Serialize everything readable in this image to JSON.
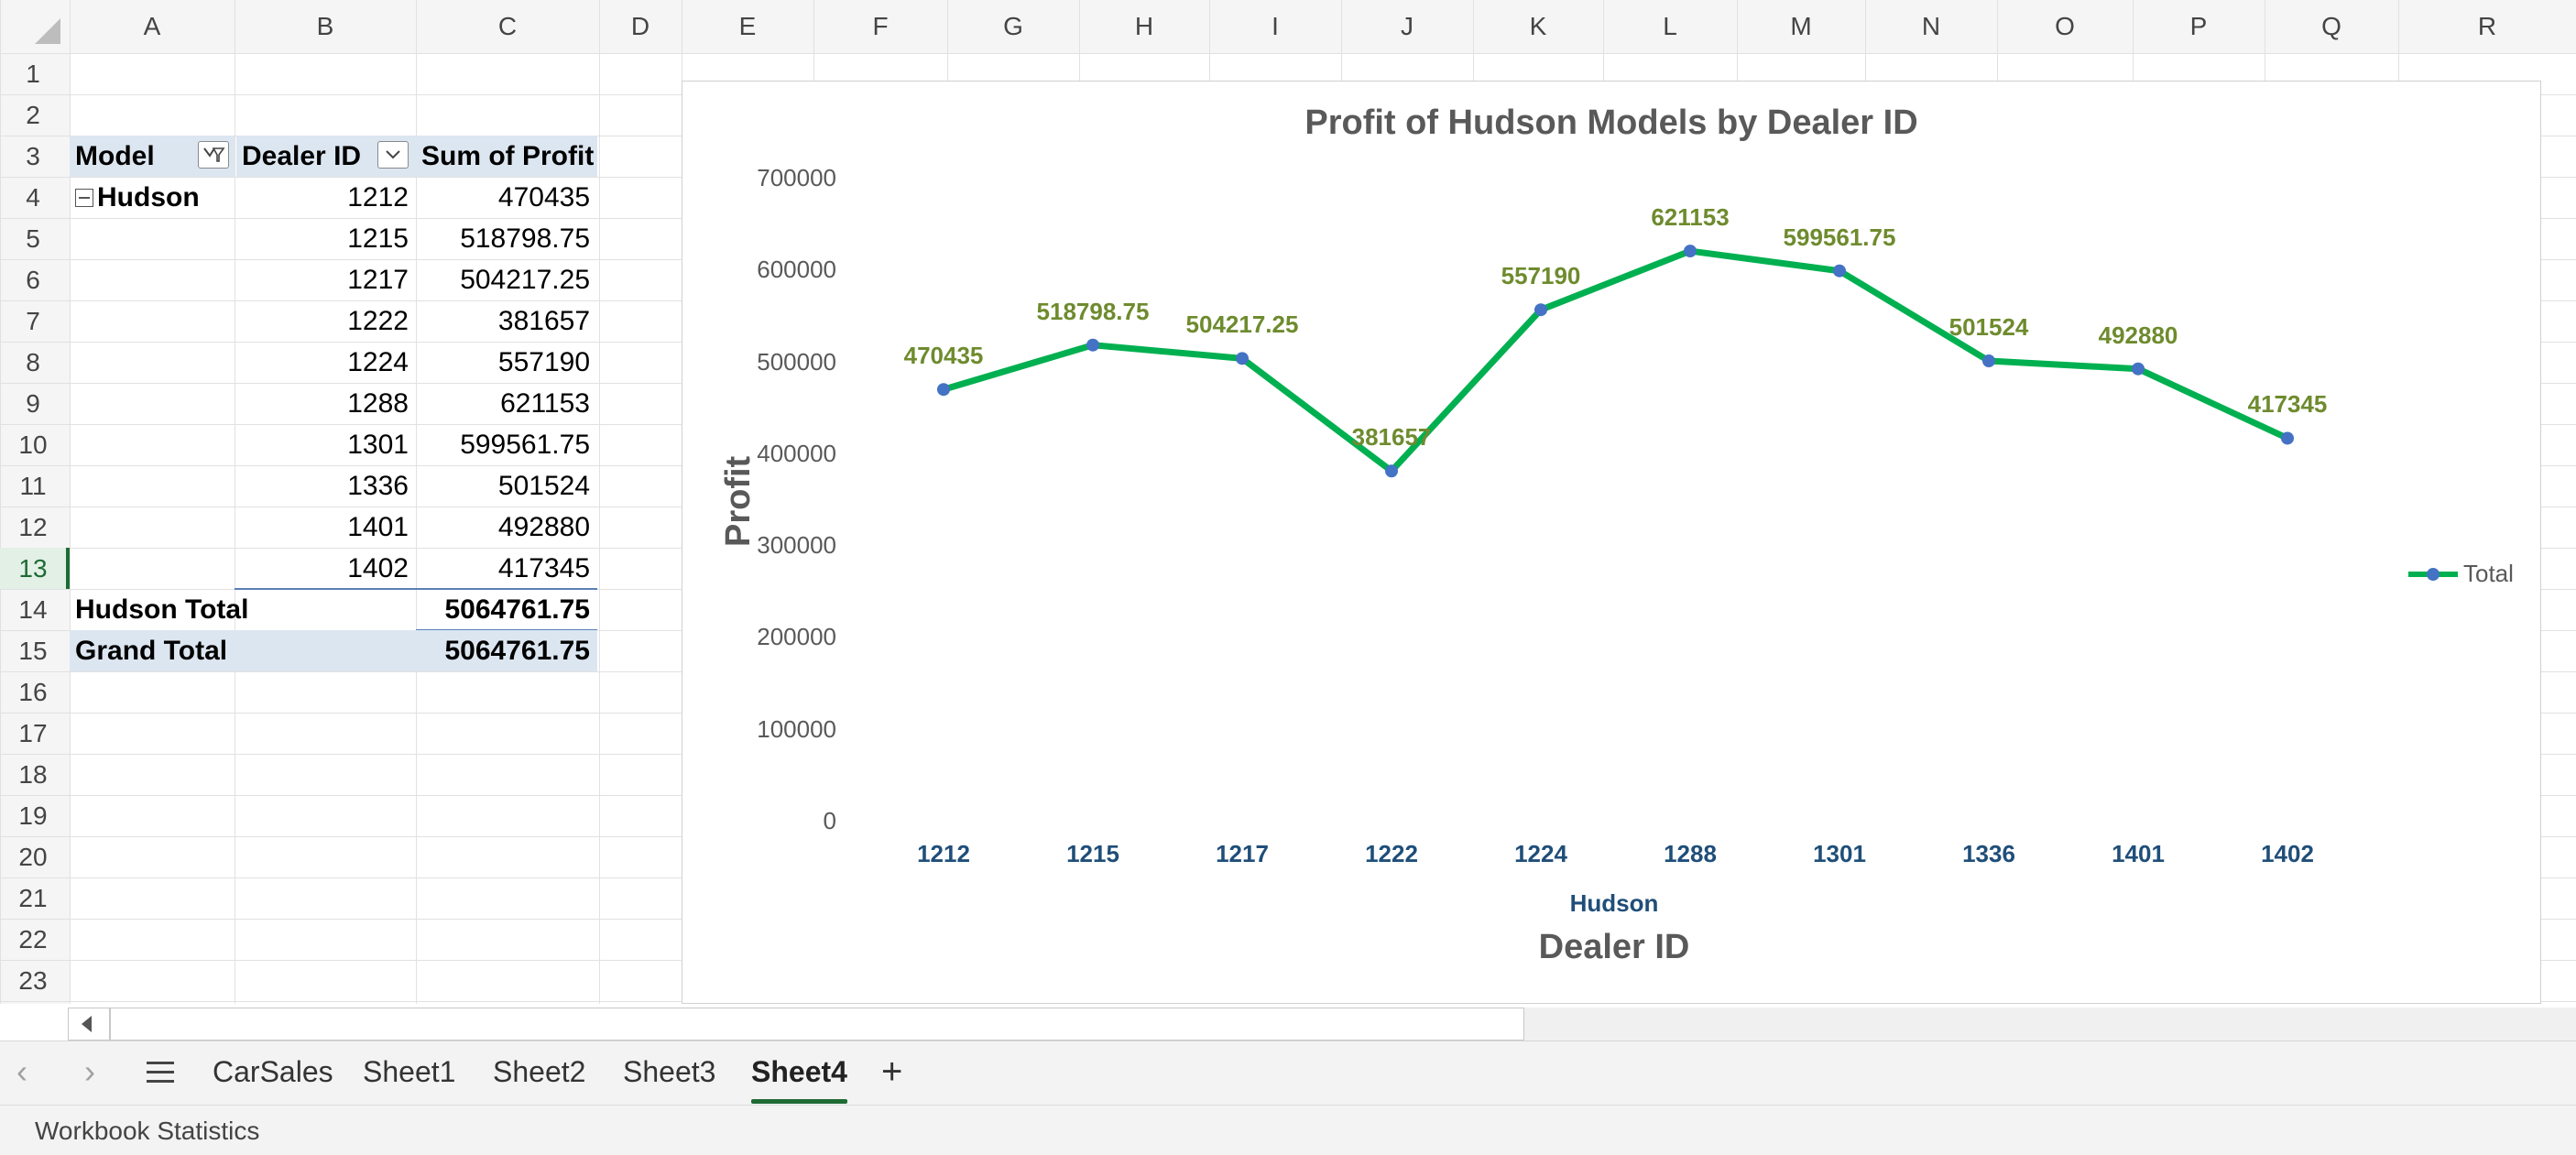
{
  "columns": [
    "A",
    "B",
    "C",
    "D",
    "E",
    "F",
    "G",
    "H",
    "I",
    "J",
    "K",
    "L",
    "M",
    "N",
    "O",
    "P",
    "Q",
    "R"
  ],
  "rows": [
    "1",
    "2",
    "3",
    "4",
    "5",
    "6",
    "7",
    "8",
    "9",
    "10",
    "11",
    "12",
    "13",
    "14",
    "15",
    "16",
    "17",
    "18",
    "19",
    "20",
    "21",
    "22",
    "23"
  ],
  "active_row": "13",
  "pivot": {
    "headers": {
      "model": "Model",
      "dealer": "Dealer ID",
      "sum": "Sum of Profit"
    },
    "group": "Hudson",
    "rows": [
      {
        "dealer": "1212",
        "profit": "470435"
      },
      {
        "dealer": "1215",
        "profit": "518798.75"
      },
      {
        "dealer": "1217",
        "profit": "504217.25"
      },
      {
        "dealer": "1222",
        "profit": "381657"
      },
      {
        "dealer": "1224",
        "profit": "557190"
      },
      {
        "dealer": "1288",
        "profit": "621153"
      },
      {
        "dealer": "1301",
        "profit": "599561.75"
      },
      {
        "dealer": "1336",
        "profit": "501524"
      },
      {
        "dealer": "1401",
        "profit": "492880"
      },
      {
        "dealer": "1402",
        "profit": "417345"
      }
    ],
    "subtotal_label": "Hudson Total",
    "subtotal_value": "5064761.75",
    "grand_label": "Grand Total",
    "grand_value": "5064761.75"
  },
  "chart_data": {
    "type": "line",
    "title": "Profit of Hudson Models by Dealer ID",
    "xlabel": "Dealer ID",
    "ylabel": "Profit",
    "group_label": "Hudson",
    "categories": [
      "1212",
      "1215",
      "1217",
      "1222",
      "1224",
      "1288",
      "1301",
      "1336",
      "1401",
      "1402"
    ],
    "series": [
      {
        "name": "Total",
        "values": [
          470435,
          518798.75,
          504217.25,
          381657,
          557190,
          621153,
          599561.75,
          501524,
          492880,
          417345
        ]
      }
    ],
    "data_labels": [
      "470435",
      "518798.75",
      "504217.25",
      "381657",
      "557190",
      "621153",
      "599561.75",
      "501524",
      "492880",
      "417345"
    ],
    "yticks": [
      "0",
      "100000",
      "200000",
      "300000",
      "400000",
      "500000",
      "600000",
      "700000"
    ],
    "ylim": [
      0,
      700000
    ],
    "grid": false,
    "legend_position": "right",
    "line_color": "#00b050",
    "marker_color": "#4472c4",
    "label_color": "#6e8b2e"
  },
  "sheet_tabs": [
    "CarSales",
    "Sheet1",
    "Sheet2",
    "Sheet3",
    "Sheet4"
  ],
  "active_tab": "Sheet4",
  "add_tab_label": "+",
  "status": "Workbook Statistics"
}
